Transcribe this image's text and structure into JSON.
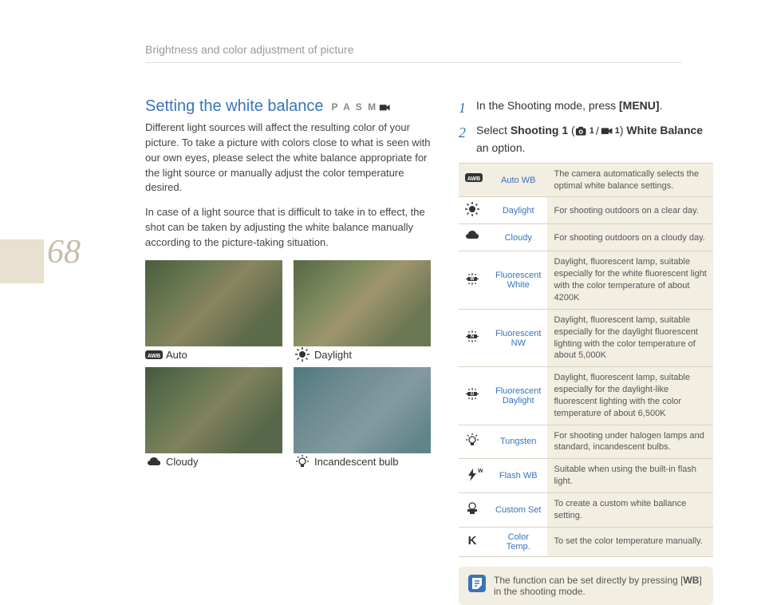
{
  "header": {
    "breadcrumb": "Brightness and color adjustment of picture"
  },
  "page_number": "68",
  "left": {
    "title": "Setting the white balance",
    "modes": "P A S M",
    "para1": "Different light sources will affect the resulting color of your picture. To take a picture with colors close to what is seen with our own eyes, please select the white balance appropriate for the light source or manually adjust the color temperature desired.",
    "para2": "In case of a light source that is difficult to take in to effect, the shot can be taken by adjusting the white balance manually according to the picture-taking situation.",
    "examples": [
      {
        "label": "Auto",
        "icon": "awb"
      },
      {
        "label": "Daylight",
        "icon": "sun"
      },
      {
        "label": "Cloudy",
        "icon": "cloud"
      },
      {
        "label": "Incandescent bulb",
        "icon": "bulb"
      }
    ]
  },
  "right": {
    "steps": [
      {
        "num": "1",
        "pre": "In the Shooting mode, press ",
        "bold": "[MENU]",
        "post": "."
      },
      {
        "num": "2",
        "pre": "Select ",
        "bold": "Shooting 1",
        "mid": " ( ",
        "icons": true,
        "mid2": " ) ",
        "bold2": "White Balance",
        "post": "  an option."
      }
    ],
    "step2_inline": {
      "cam": "1",
      "vid": "1"
    },
    "table": [
      {
        "icon": "awb",
        "name": "Auto WB",
        "desc": "The camera automatically selects the optimal white balance settings."
      },
      {
        "icon": "sun",
        "name": "Daylight",
        "desc": "For shooting outdoors on a clear day."
      },
      {
        "icon": "cloud",
        "name": "Cloudy",
        "desc": "For shooting outdoors on a cloudy day."
      },
      {
        "icon": "fl-w",
        "name": "Fluorescent White",
        "desc": "Daylight, fluorescent lamp, suitable especially for the white fluorescent light with the color temperature of about 4200K"
      },
      {
        "icon": "fl-n",
        "name": "Fluorescent NW",
        "desc": "Daylight, fluorescent lamp, suitable especially for the daylight fluorescent lighting with the color temperature of about 5,000K"
      },
      {
        "icon": "fl-d",
        "name": "Fluorescent Daylight",
        "desc": "Daylight, fluorescent lamp, suitable especially for the daylight-like fluorescent lighting with the color temperature of about 6,500K"
      },
      {
        "icon": "bulb",
        "name": "Tungsten",
        "desc": "For shooting under halogen lamps and standard, incandescent bulbs."
      },
      {
        "icon": "flash",
        "name": "Flash WB",
        "desc": "Suitable when using the built-in flash light."
      },
      {
        "icon": "custom",
        "name": "Custom Set",
        "desc": "To create a custom white ballance setting."
      },
      {
        "icon": "k",
        "name": "Color Temp.",
        "desc": "To set the color temperature manually."
      }
    ],
    "note": {
      "pre": "The function can be set directly by pressing [",
      "bold": "WB",
      "post": "] in the shooting mode."
    }
  }
}
